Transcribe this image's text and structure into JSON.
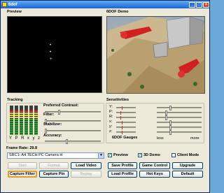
{
  "window": {
    "title": "6dof"
  },
  "titlebar": {
    "minimize": "_",
    "maximize": "□",
    "close": "×"
  },
  "preview": {
    "label": "Preview",
    "dots": [
      "•",
      "•",
      "+"
    ]
  },
  "demo": {
    "label": "6DOF Demo"
  },
  "tracking": {
    "label": "Tracking",
    "axis_labels": [
      "Y",
      "P",
      "R",
      "x",
      "y",
      "z"
    ],
    "meter_levels": [
      0.86,
      0.86,
      0.86,
      0.86,
      0.86,
      0.86
    ],
    "controls": [
      {
        "label": "Preferred Contrast:",
        "value": 0.25
      },
      {
        "label": "Filter:",
        "value": 0.0
      },
      {
        "label": "Stabilizer:",
        "value": 0.0
      },
      {
        "label": "Accuracy:",
        "value": 0.4
      }
    ]
  },
  "sensitivities": {
    "label": "Sensitivities",
    "axes": [
      {
        "label": "Y:",
        "value": 0.3
      },
      {
        "label": "P:",
        "value": 0.2
      },
      {
        "label": "R:",
        "value": 0.2
      },
      {
        "label": "x:",
        "value": 0.3
      },
      {
        "label": "y:",
        "value": 0.3
      },
      {
        "label": "z:",
        "value": 0.3
      }
    ],
    "gauges_label": "6DOF Gauges",
    "less_label": "less",
    "more_label": "more"
  },
  "frame_rate": {
    "label": "Frame Rate: 29.8"
  },
  "source": {
    "selected": "SRC1: A4 TECH PC Camera H"
  },
  "checkboxes": {
    "preview": {
      "label": "Preview",
      "checked": true
    },
    "demo_3d": {
      "label": "3D Demo",
      "checked": true
    },
    "client_mode": {
      "label": "Client Mode",
      "checked": false
    }
  },
  "buttons": {
    "start": "Start",
    "format": "Format",
    "capture_filter": "Capture Filter",
    "capture_pin": "Capture Pin",
    "load_video": "Load Video",
    "replay": "Replay",
    "save_profile": "Save Profile",
    "load_profile": "Load Profile",
    "game_control": "Game Control",
    "hot_keys": "Hot Keys",
    "upgrade": "Upgrade",
    "default": "Default"
  },
  "colors": {
    "title_blue": "#1c62d6",
    "meter_low": "#30b030",
    "meter_mid": "#e0d020",
    "meter_high": "#e03030",
    "window_bg": "#ece9d8"
  }
}
